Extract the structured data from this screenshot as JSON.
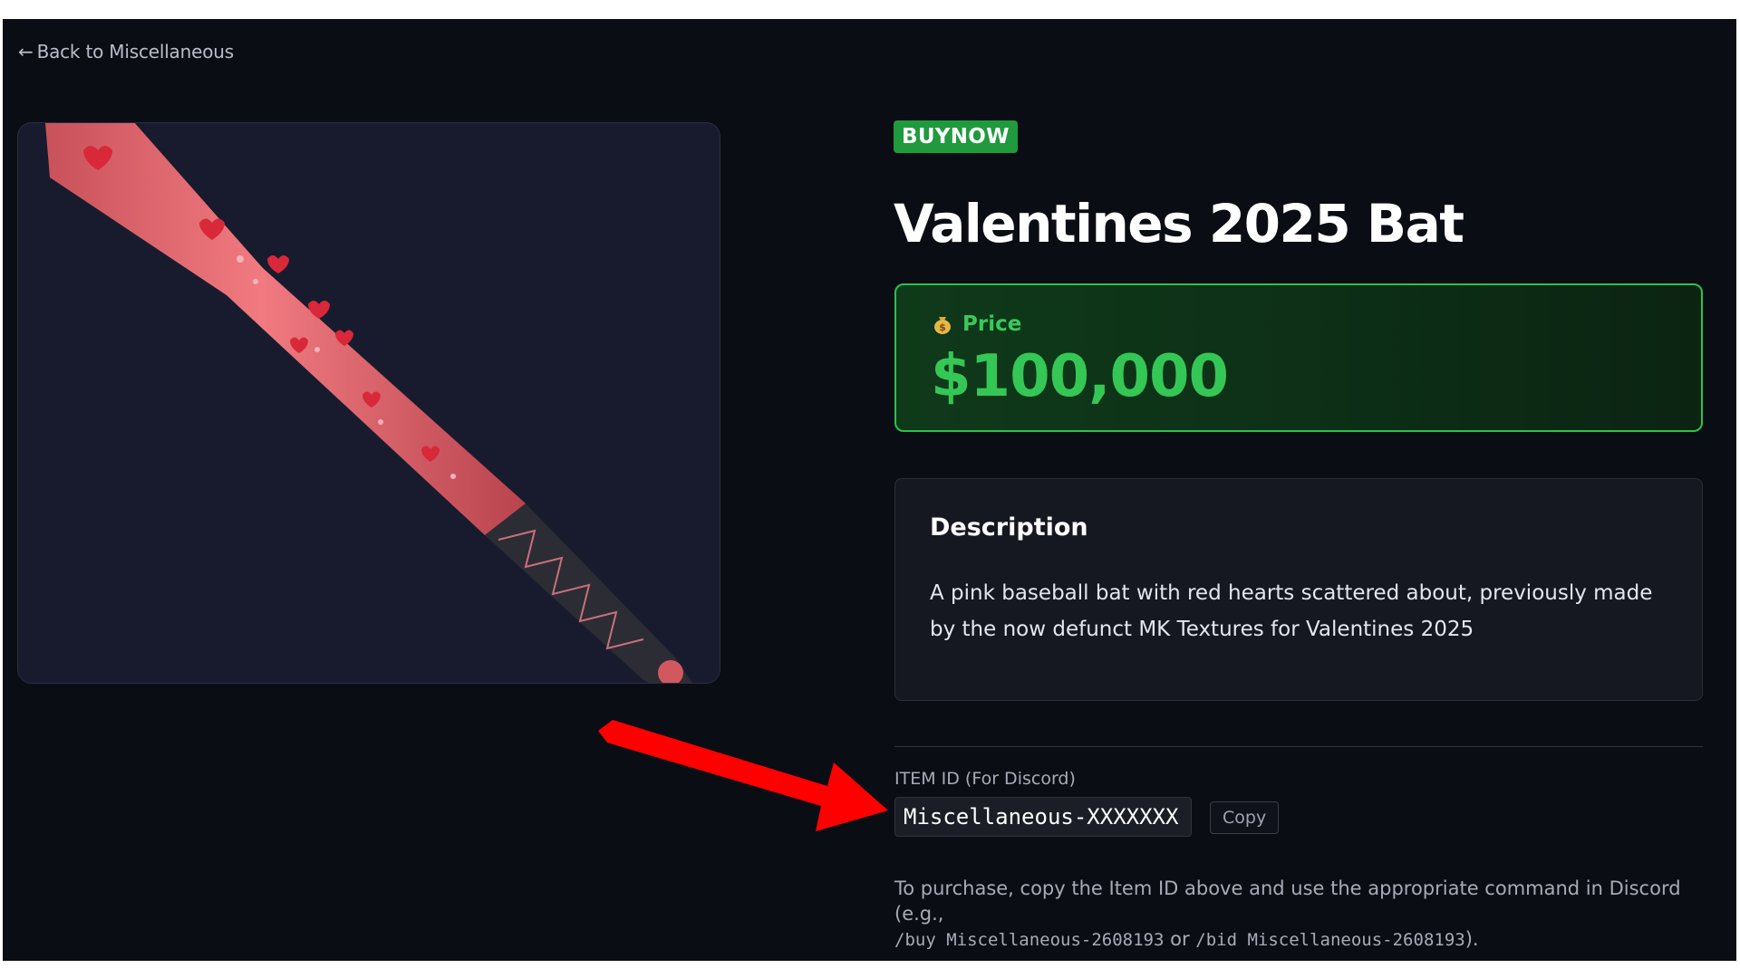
{
  "nav": {
    "back_arrow": "←",
    "back_label": "Back to Miscellaneous"
  },
  "item": {
    "badge": "BUYNOW",
    "title": "Valentines 2025 Bat",
    "image_alt": "Pink baseball bat with red hearts"
  },
  "price": {
    "icon": "money-bag-icon",
    "label": "Price",
    "value": "$100,000"
  },
  "description": {
    "title": "Description",
    "body": "A pink baseball bat with red hearts scattered about, previously made by the now defunct MK Textures for Valentines 2025"
  },
  "item_id": {
    "label": "ITEM ID (For Discord)",
    "value": "Miscellaneous-XXXXXXX",
    "copy_label": "Copy"
  },
  "help": {
    "prefix": "To purchase, copy the Item ID above and use the appropriate command in Discord (e.g.,",
    "cmd_buy": "/buy Miscellaneous-2608193",
    "or": "or",
    "cmd_bid": "/bid Miscellaneous-2608193",
    "suffix": ")."
  },
  "colors": {
    "background": "#0b0d14",
    "badge": "#1f9a3c",
    "price_accent": "#34c755",
    "annotation_arrow": "#ff0000"
  }
}
